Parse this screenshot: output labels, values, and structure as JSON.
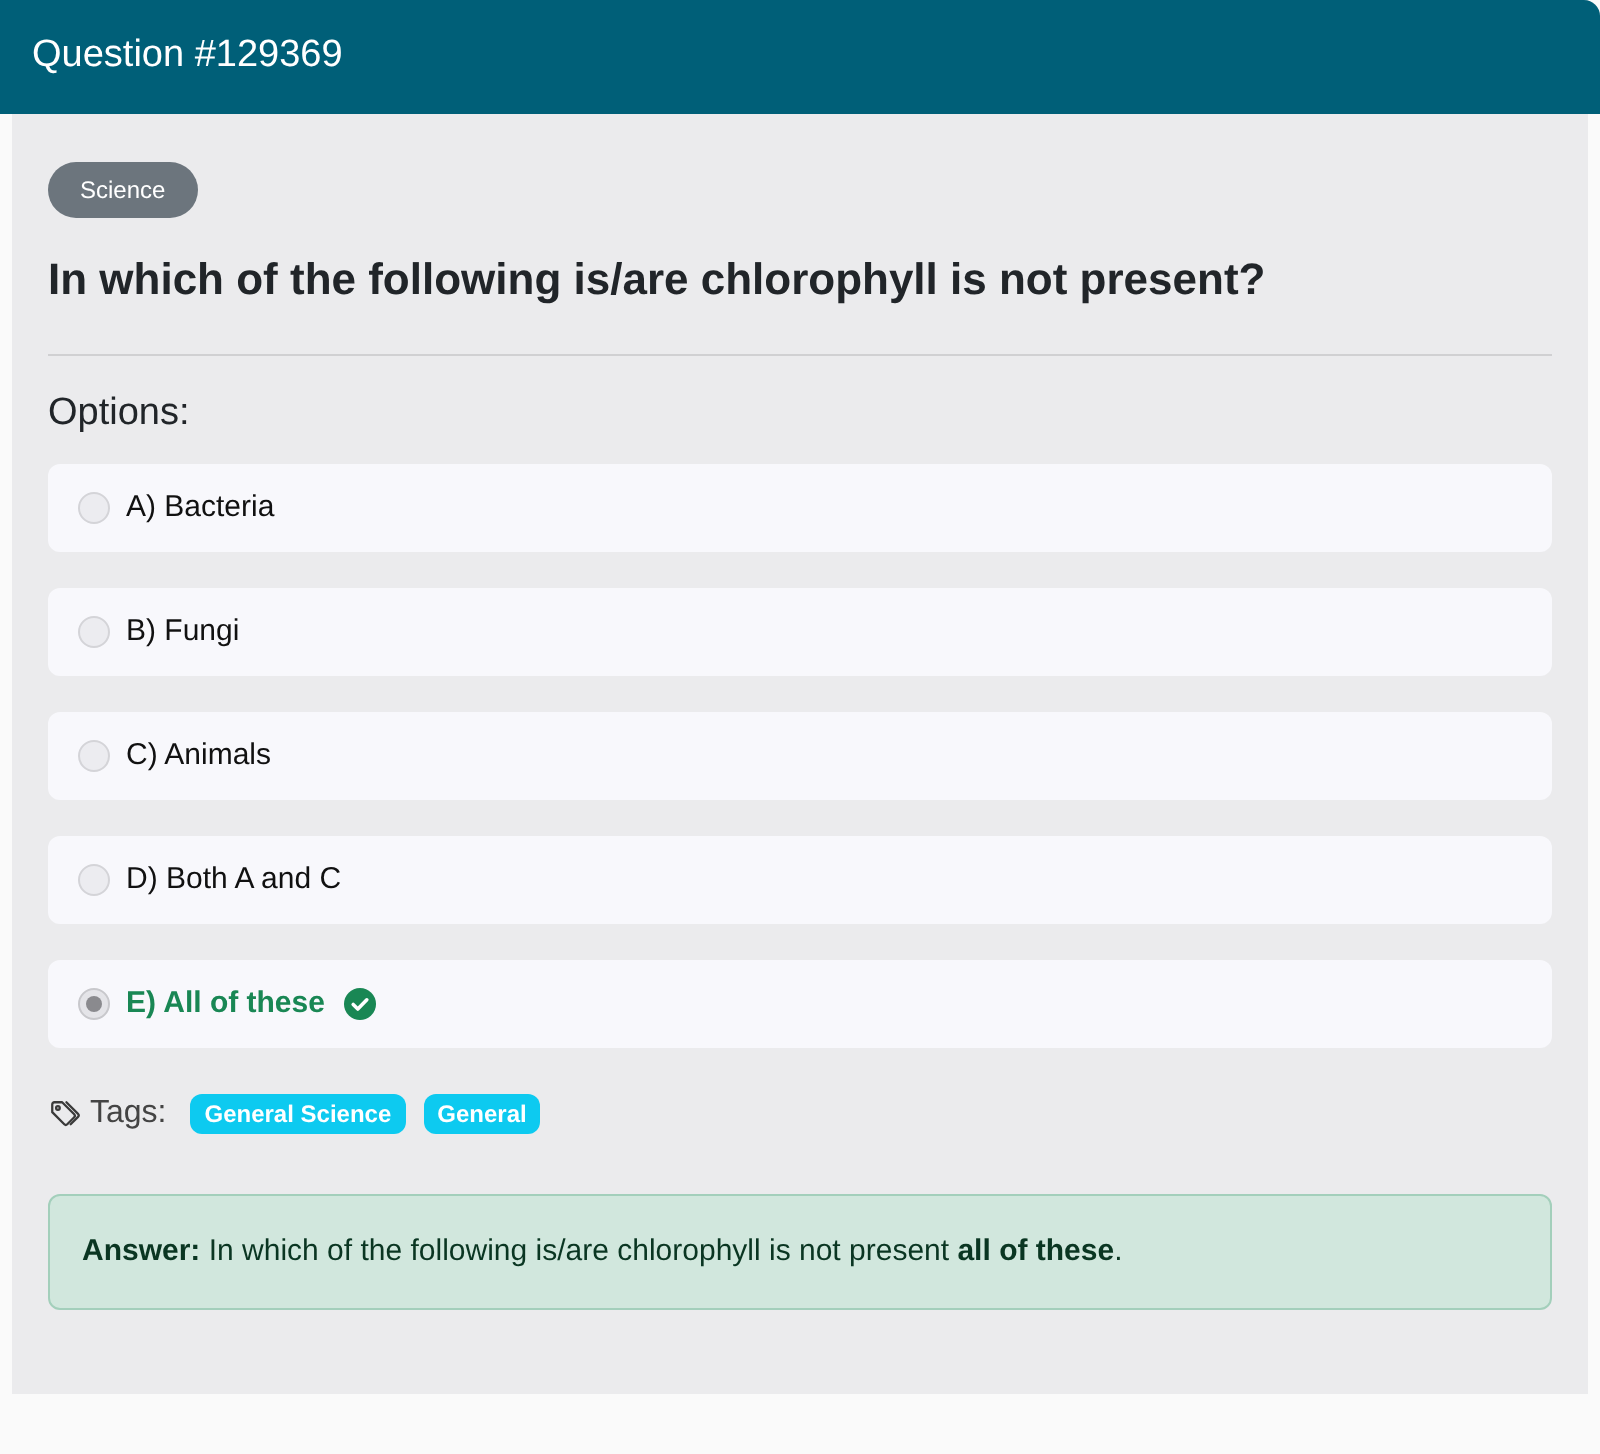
{
  "header": {
    "title": "Question #129369"
  },
  "category": "Science",
  "question": "In which of the following is/are chlorophyll is not present?",
  "options_label": "Options:",
  "options": [
    {
      "label": "A) Bacteria",
      "selected": false,
      "correct": false
    },
    {
      "label": "B) Fungi",
      "selected": false,
      "correct": false
    },
    {
      "label": "C) Animals",
      "selected": false,
      "correct": false
    },
    {
      "label": "D) Both A and C",
      "selected": false,
      "correct": false
    },
    {
      "label": "E) All of these",
      "selected": true,
      "correct": true
    }
  ],
  "tags": {
    "label": "Tags:",
    "items": [
      "General Science",
      "General"
    ]
  },
  "answer": "**Answer:** In which of the following is/are chlorophyll is not present **all of these**."
}
